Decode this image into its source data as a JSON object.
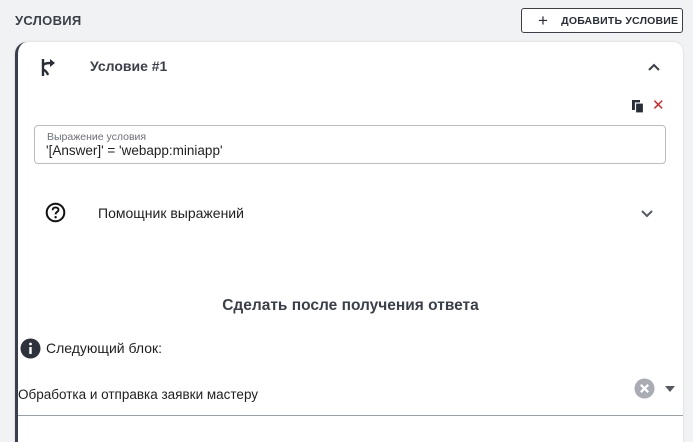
{
  "header": {
    "section_title": "УСЛОВИЯ",
    "add_button_label": "ДОБАВИТЬ УСЛОВИЕ"
  },
  "condition": {
    "title": "Условие #1",
    "expression": {
      "label": "Выражение условия",
      "value": "'[Answer]' = 'webapp:miniapp'"
    },
    "helper_label": "Помощник выражений",
    "after_title": "Сделать после получения ответа",
    "next_block_label": "Следующий блок:",
    "next_block_value": "Обработка и отправка заявки мастеру"
  },
  "colors": {
    "accent": "#3a3f4d",
    "delete": "#d12a2a",
    "background": "#f1f2f4"
  },
  "icons": [
    "plus-icon",
    "branch-icon",
    "chevron-up-icon",
    "copy-icon",
    "delete-icon",
    "help-icon",
    "chevron-down-icon",
    "info-icon",
    "clear-icon",
    "dropdown-arrow-icon"
  ]
}
